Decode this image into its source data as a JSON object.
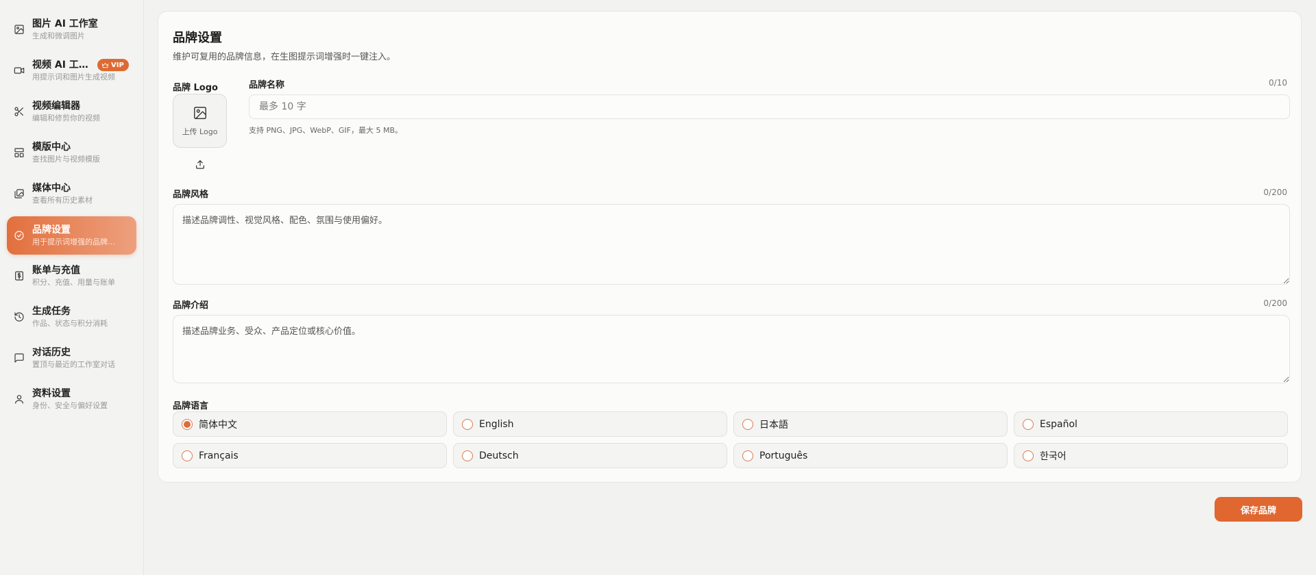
{
  "sidebar": {
    "items": [
      {
        "title": "图片 AI 工作室",
        "sub": "生成和微调图片",
        "icon": "image-icon"
      },
      {
        "title": "视频 AI 工作室",
        "sub": "用提示词和图片生成视频",
        "icon": "video-icon",
        "badge": "VIP"
      },
      {
        "title": "视频编辑器",
        "sub": "编辑和修剪你的视频",
        "icon": "scissors-icon"
      },
      {
        "title": "模版中心",
        "sub": "查找图片与视频模版",
        "icon": "layout-icon"
      },
      {
        "title": "媒体中心",
        "sub": "查看所有历史素材",
        "icon": "gallery-icon"
      },
      {
        "title": "品牌设置",
        "sub": "用于提示词增强的品牌信息",
        "icon": "check-circle-icon",
        "active": true
      },
      {
        "title": "账单与充值",
        "sub": "积分、充值、用量与账单",
        "icon": "dollar-icon"
      },
      {
        "title": "生成任务",
        "sub": "作品、状态与积分消耗",
        "icon": "history-icon"
      },
      {
        "title": "对话历史",
        "sub": "置顶与最近的工作室对话",
        "icon": "chat-icon"
      },
      {
        "title": "资料设置",
        "sub": "身份、安全与偏好设置",
        "icon": "user-icon"
      }
    ]
  },
  "page": {
    "title": "品牌设置",
    "description": "维护可复用的品牌信息，在生图提示词增强时一键注入。"
  },
  "logo": {
    "label": "品牌 Logo",
    "upload_text": "上传 Logo"
  },
  "brand_name": {
    "label": "品牌名称",
    "counter": "0/10",
    "placeholder": "最多 10 字",
    "hint": "支持 PNG、JPG、WebP、GIF，最大 5 MB。"
  },
  "brand_style": {
    "label": "品牌风格",
    "counter": "0/200",
    "placeholder": "描述品牌调性、视觉风格、配色、氛围与使用偏好。"
  },
  "brand_intro": {
    "label": "品牌介绍",
    "counter": "0/200",
    "placeholder": "描述品牌业务、受众、产品定位或核心价值。"
  },
  "brand_language": {
    "label": "品牌语言",
    "options": [
      "简体中文",
      "English",
      "日本語",
      "Español",
      "Français",
      "Deutsch",
      "Português",
      "한국어"
    ],
    "selected": "简体中文"
  },
  "actions": {
    "save_label": "保存品牌"
  },
  "colors": {
    "accent": "#e0672f",
    "active_gradient_start": "#e2703d",
    "active_gradient_end": "#eda07e"
  }
}
